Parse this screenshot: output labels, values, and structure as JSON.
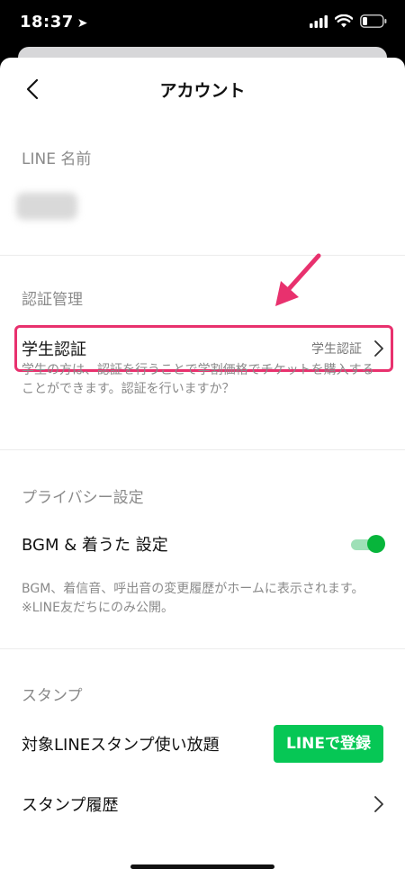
{
  "status": {
    "time": "18:37"
  },
  "header": {
    "title": "アカウント"
  },
  "sections": {
    "line_name": {
      "label": "LINE 名前"
    },
    "auth": {
      "label": "認証管理",
      "student_row": {
        "label": "学生認証",
        "value": "学生認証"
      },
      "description": "学生の方は、認証を行うことで学割価格でチケットを購入することができます。認証を行いますか？"
    },
    "privacy": {
      "label": "プライバシー設定",
      "bgm_row": {
        "label": "BGM & 着うた 設定",
        "toggle_on": true
      },
      "description": "BGM、着信音、呼出音の変更履歴がホームに表示されます。※LINE友だちにのみ公開。"
    },
    "stamp": {
      "label": "スタンプ",
      "unlimited_row": {
        "label": "対象LINEスタンプ使い放題",
        "button": "LINEで登録"
      },
      "history_row": {
        "label": "スタンプ履歴"
      }
    }
  },
  "colors": {
    "accent_green": "#06c755",
    "highlight": "#e8316e"
  }
}
